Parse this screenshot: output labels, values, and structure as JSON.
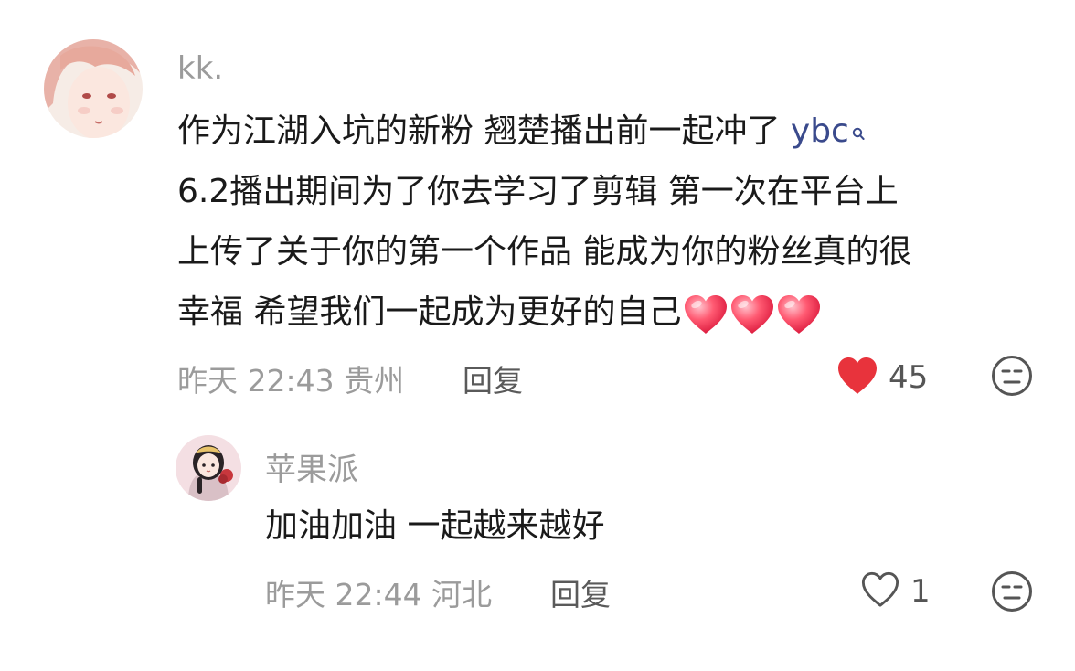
{
  "comment": {
    "username": "kk.",
    "lines": [
      "作为江湖入坑的新粉 翘楚播出前一起冲了 ",
      "6.2播出期间为了你去学习了剪辑 第一次在平台上",
      "上传了关于你的第一个作品 能成为你的粉丝真的很",
      "幸福 希望我们一起成为更好的自己"
    ],
    "mention": "ybc",
    "time": "昨天 22:43",
    "location": "贵州",
    "reply_label": "回复",
    "like_count": "45",
    "liked": true,
    "heart_emoji_count": 3
  },
  "reply": {
    "username": "苹果派",
    "text": "加油加油 一起越来越好",
    "time": "昨天 22:44",
    "location": "河北",
    "reply_label": "回复",
    "like_count": "1",
    "liked": false
  },
  "icons": {
    "like_filled": "heart-filled-icon",
    "like_outline": "heart-outline-icon",
    "dislike": "dislike-face-icon",
    "mention": "search-icon"
  },
  "colors": {
    "like_red": "#e8333c",
    "muted_text": "#9b9b9b",
    "mention_blue": "#3a4a8c"
  }
}
